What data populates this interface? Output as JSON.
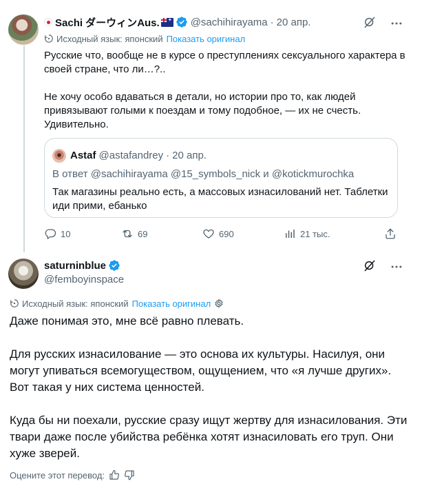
{
  "tweet1": {
    "display_name": "Sachi ダーウィンAus.",
    "handle": "@sachihirayama",
    "date": "20 апр.",
    "translation": {
      "label": "Исходный язык: японский",
      "link": "Показать оригинал"
    },
    "body": [
      "Русские что, вообще не в курсе о преступлениях сексуального характера в своей стране, что ли…?..",
      "Не хочу особо вдаваться в детали, но истории про то, как людей привязывают голыми к поездам и тому подобное, — их не счесть. Удивительно."
    ],
    "quote": {
      "display_name": "Astaf",
      "handle": "@astafandrey",
      "date": "20 апр.",
      "reply_to": "В ответ @sachihirayama @15_symbols_nick и @kotickmurochka",
      "body": "Так магазины реально есть, а массовых изнасилований нет. Таблетки иди прими, ебанько"
    },
    "stats": {
      "replies": "10",
      "reposts": "69",
      "likes": "690",
      "views": "21 тыс."
    },
    "icons": {
      "grok": "grok-icon",
      "more": "more-icon",
      "translate": "translate-icon",
      "verified": "verified-badge-icon",
      "flag_left": "japan-flag-icon",
      "flag_right": "australia-flag-icon",
      "reply": "reply-icon",
      "repost": "repost-icon",
      "like": "heart-icon",
      "views": "views-icon",
      "share": "share-icon"
    }
  },
  "tweet2": {
    "display_name": "saturninblue",
    "handle": "@femboyinspace",
    "translation": {
      "label": "Исходный язык: японский",
      "link": "Показать оригинал"
    },
    "body": [
      "Даже понимая это, мне всё равно плевать.",
      "Для русских изнасилование — это основа их культуры. Насилуя, они могут упиваться всемогуществом, ощущением, что «я лучше других». Вот такая у них система ценностей.",
      "Куда бы ни поехали, русские сразу ищут жертву для изнасилования. Эти твари даже после убийства ребёнка хотят изнасиловать его труп. Они хуже зверей."
    ],
    "rate_label": "Оцените этот перевод:",
    "icons": {
      "grok": "grok-icon",
      "more": "more-icon",
      "translate": "translate-icon",
      "settings": "gear-icon",
      "verified": "verified-badge-icon",
      "thumbs_up": "thumbs-up-icon",
      "thumbs_down": "thumbs-down-icon"
    }
  },
  "colors": {
    "text": "#0f1419",
    "secondary": "#536471",
    "link": "#1d9bf0",
    "border": "#cfd9de",
    "verified": "#1d9bf0"
  }
}
